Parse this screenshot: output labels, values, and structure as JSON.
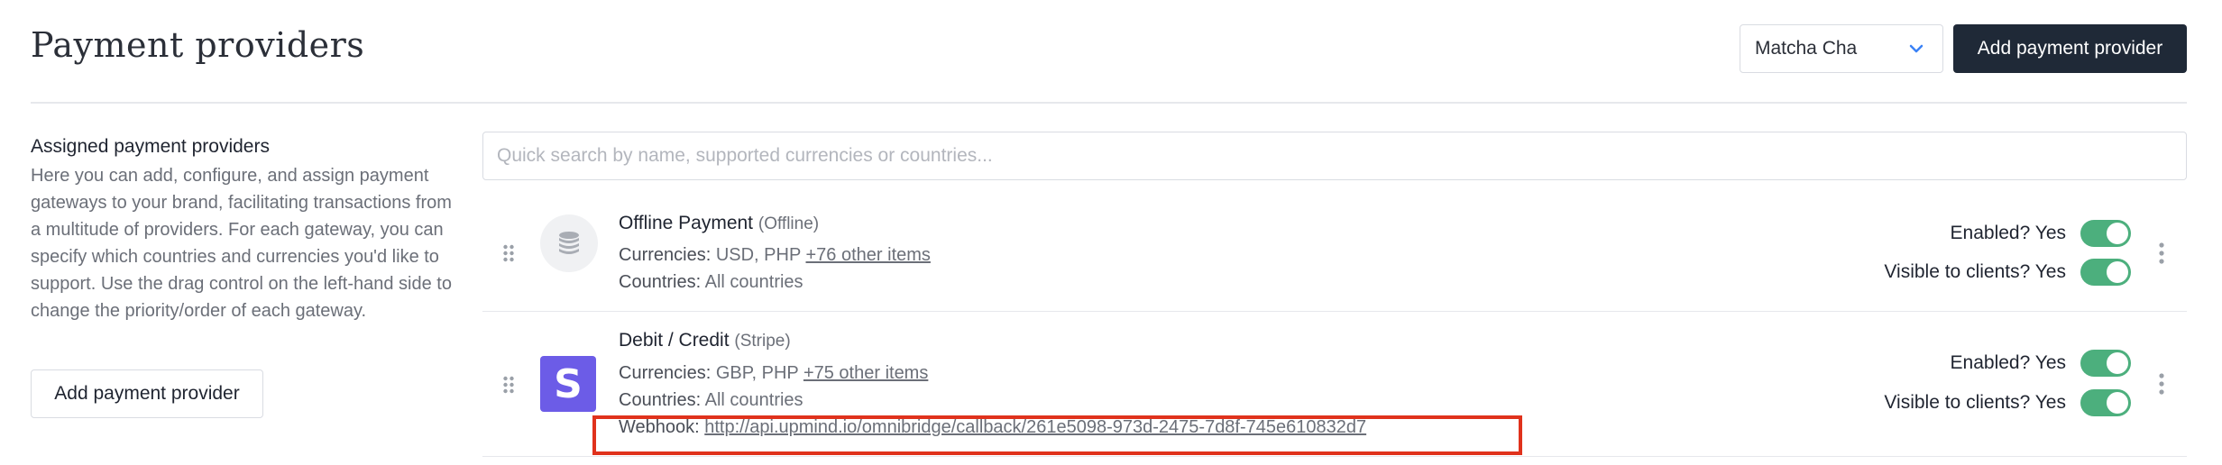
{
  "header": {
    "title": "Payment providers",
    "brand_select_value": "Matcha Cha",
    "add_button_label": "Add payment provider"
  },
  "sidebar": {
    "heading": "Assigned payment providers",
    "description": "Here you can add, configure, and assign payment gateways to your brand, facilitating transactions from a multitude of providers. For each gateway, you can specify which countries and currencies you'd like to support. Use the drag control on the left-hand side to change the priority/order of each gateway.",
    "add_button_label": "Add payment provider"
  },
  "search": {
    "placeholder": "Quick search by name, supported currencies or countries..."
  },
  "providers": [
    {
      "name": "Offline Payment",
      "type": "(Offline)",
      "currencies_label": "Currencies:",
      "currencies": "USD, PHP",
      "currencies_more": "+76 other items",
      "countries_label": "Countries:",
      "countries": "All countries",
      "enabled_label": "Enabled? Yes",
      "visible_label": "Visible to clients? Yes",
      "enabled": true,
      "visible": true,
      "logo_icon": "coins-icon"
    },
    {
      "name": "Debit / Credit",
      "type": "(Stripe)",
      "currencies_label": "Currencies:",
      "currencies": "GBP, PHP",
      "currencies_more": "+75 other items",
      "countries_label": "Countries:",
      "countries": "All countries",
      "webhook_label": "Webhook:",
      "webhook_url": "http://api.upmind.io/omnibridge/callback/261e5098-973d-2475-7d8f-745e610832d7",
      "enabled_label": "Enabled? Yes",
      "visible_label": "Visible to clients? Yes",
      "enabled": true,
      "visible": true,
      "logo_letter": "S"
    }
  ],
  "colors": {
    "primary_button": "#1f2937",
    "toggle_on": "#4caf7d",
    "stripe_brand": "#6c5ce7",
    "highlight": "#e0321c"
  }
}
